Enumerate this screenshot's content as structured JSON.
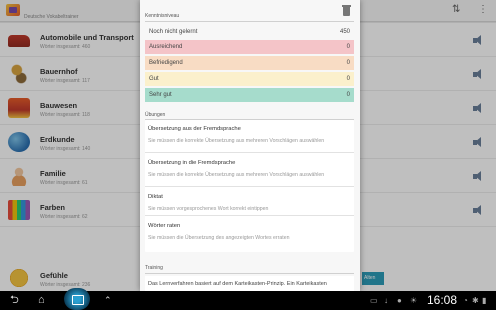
{
  "topbar": {
    "subtitle": "Deutsche Vokabeltrainer"
  },
  "categories": [
    {
      "title": "Automobile und Transport",
      "sub": "Wörter insgesamt: 460"
    },
    {
      "title": "Bauernhof",
      "sub": "Wörter insgesamt: 117"
    },
    {
      "title": "Bauwesen",
      "sub": "Wörter insgesamt: 118"
    },
    {
      "title": "Erdkunde",
      "sub": "Wörter insgesamt: 140"
    },
    {
      "title": "Familie",
      "sub": "Wörter insgesamt: 61"
    },
    {
      "title": "Farben",
      "sub": "Wörter insgesamt: 62"
    },
    {
      "title": "Gefühle",
      "sub": "Wörter insgesamt: 236"
    }
  ],
  "background_button": "Alten",
  "dialog": {
    "knowledge_header": "Kenntnisniveau",
    "levels": [
      {
        "label": "Noch nicht gelernt",
        "count": "450",
        "color": "#f7f7f7"
      },
      {
        "label": "Ausreichend",
        "count": "0",
        "color": "#f4c4c8"
      },
      {
        "label": "Befriedigend",
        "count": "0",
        "color": "#f8dcc4"
      },
      {
        "label": "Gut",
        "count": "0",
        "color": "#fbf0cc"
      },
      {
        "label": "Sehr gut",
        "count": "0",
        "color": "#a6dccc"
      }
    ],
    "exercises_header": "Übungen",
    "exercises": [
      {
        "title": "Übersetzung aus der Fremdsprache",
        "desc": "Sie müssen die korrekte Übersetzung aus mehreren Vorschlägen auswählen"
      },
      {
        "title": "Übersetzung in die Fremdsprache",
        "desc": "Sie müssen die korrekte Übersetzung aus mehreren Vorschlägen auswählen"
      },
      {
        "title": "Diktat",
        "desc": "Sie müssen vorgesprochenes Wort korrekt eintippen"
      },
      {
        "title": "Wörter raten",
        "desc": "Sie müssen die Übersetzung des angezeigten Wortes erraten"
      }
    ],
    "training_header": "Training",
    "training_text": "Das Lernverfahren basiert auf dem Karteikasten-Prinzip. Ein Karteikasten"
  },
  "statusbar": {
    "time": "16:08"
  }
}
